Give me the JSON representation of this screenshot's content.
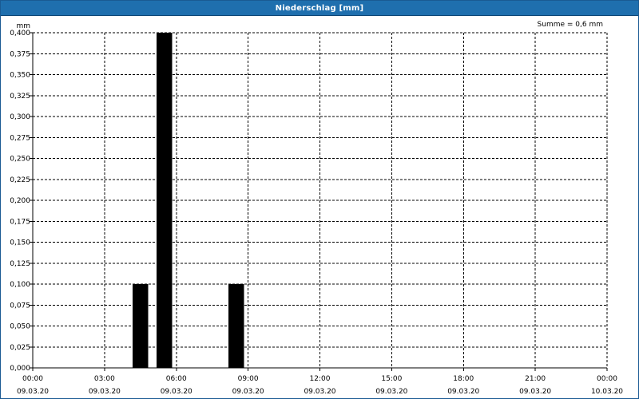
{
  "window": {
    "title": "Niederschlag [mm]"
  },
  "summary": {
    "text": "Summe = 0,6 mm"
  },
  "colors": {
    "titlebar": "#1f6fae",
    "bar": "#000000",
    "grid": "#000000"
  },
  "chart_data": {
    "type": "bar",
    "title": "Niederschlag [mm]",
    "ylabel": "mm",
    "xlabel": "",
    "ylim": [
      0,
      0.4
    ],
    "xlim_hours": [
      0,
      24
    ],
    "grid": true,
    "y_ticks": [
      "0,000",
      "0,025",
      "0,050",
      "0,075",
      "0,100",
      "0,125",
      "0,150",
      "0,175",
      "0,200",
      "0,225",
      "0,250",
      "0,275",
      "0,300",
      "0,325",
      "0,350",
      "0,375",
      "0,400"
    ],
    "y_tick_values": [
      0,
      0.025,
      0.05,
      0.075,
      0.1,
      0.125,
      0.15,
      0.175,
      0.2,
      0.225,
      0.25,
      0.275,
      0.3,
      0.325,
      0.35,
      0.375,
      0.4
    ],
    "x_ticks": [
      {
        "hour": 0,
        "time": "00:00",
        "date": "09.03.20"
      },
      {
        "hour": 3,
        "time": "03:00",
        "date": "09.03.20"
      },
      {
        "hour": 6,
        "time": "06:00",
        "date": "09.03.20"
      },
      {
        "hour": 9,
        "time": "09:00",
        "date": "09.03.20"
      },
      {
        "hour": 12,
        "time": "12:00",
        "date": "09.03.20"
      },
      {
        "hour": 15,
        "time": "15:00",
        "date": "09.03.20"
      },
      {
        "hour": 18,
        "time": "18:00",
        "date": "09.03.20"
      },
      {
        "hour": 21,
        "time": "21:00",
        "date": "09.03.20"
      },
      {
        "hour": 24,
        "time": "00:00",
        "date": "10.03.20"
      }
    ],
    "bars": [
      {
        "start": "04:00",
        "end": "05:00",
        "value": 0.1
      },
      {
        "start": "05:00",
        "end": "06:00",
        "value": 0.4
      },
      {
        "start": "08:00",
        "end": "09:00",
        "value": 0.1
      }
    ],
    "summary": "Summe = 0,6 mm"
  }
}
